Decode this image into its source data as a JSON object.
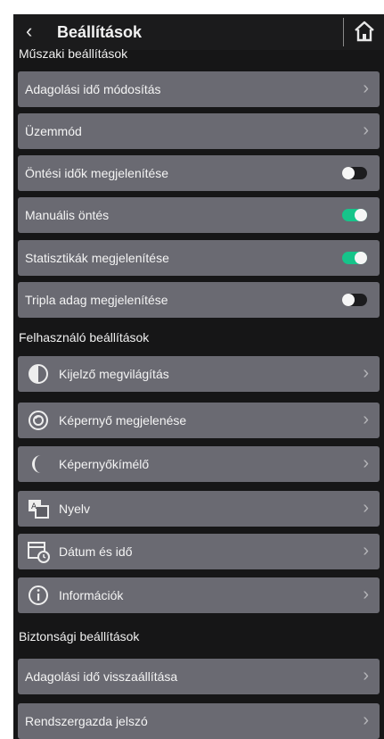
{
  "header": {
    "back_icon": "chevron-left-icon",
    "title": "Beállítások",
    "home_icon": "home-icon"
  },
  "sections": [
    {
      "title": "Műszaki beállítások",
      "items": [
        {
          "label": "Adagolási idő módosítás",
          "control": "chevron"
        },
        {
          "label": "Üzemmód",
          "control": "chevron"
        },
        {
          "label": "Öntési idők megjelenítése",
          "control": "toggle",
          "on": false
        },
        {
          "label": "Manuális öntés",
          "control": "toggle",
          "on": true
        },
        {
          "label": "Statisztikák megjelenítése",
          "control": "toggle",
          "on": true
        },
        {
          "label": "Tripla adag megjelenítése",
          "control": "toggle",
          "on": false
        }
      ]
    },
    {
      "title": "Felhasználó beállítások",
      "items": [
        {
          "label": "Kijelző megvilágítás",
          "icon": "contrast-icon",
          "control": "chevron"
        },
        {
          "label": "Képernyő megjelenése",
          "icon": "display-icon",
          "control": "chevron"
        },
        {
          "label": "Képernyőkímélő",
          "icon": "moon-icon",
          "control": "chevron"
        },
        {
          "label": "Nyelv",
          "icon": "language-icon",
          "control": "chevron"
        },
        {
          "label": "Dátum és idő",
          "icon": "calendar-clock-icon",
          "control": "chevron"
        },
        {
          "label": "Információk",
          "icon": "info-icon",
          "control": "chevron"
        }
      ]
    },
    {
      "title": "Biztonsági beállítások",
      "items": [
        {
          "label": "Adagolási idő visszaállítása",
          "control": "chevron"
        },
        {
          "label": "Rendszergazda jelszó",
          "control": "chevron"
        }
      ]
    }
  ],
  "colors": {
    "background": "#161617",
    "row": "#6a6a72",
    "toggle_on": "#16c48a",
    "toggle_off": "#1c1c1e"
  }
}
